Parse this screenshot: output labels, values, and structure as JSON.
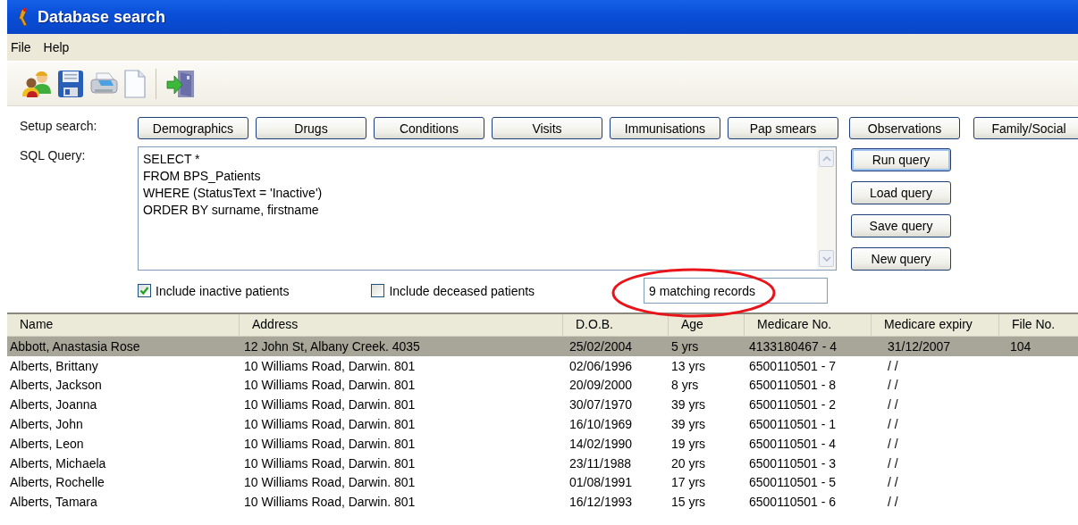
{
  "window": {
    "title": "Database search"
  },
  "menu": [
    "File",
    "Help"
  ],
  "toolbar": [
    {
      "kind": "people"
    },
    {
      "kind": "save"
    },
    {
      "kind": "print"
    },
    {
      "kind": "new"
    },
    {
      "kind": "separator"
    },
    {
      "kind": "exit"
    }
  ],
  "setup_search": {
    "label": "Setup search:",
    "buttons": [
      "Demographics",
      "Drugs",
      "Conditions",
      "Visits",
      "Immunisations",
      "Pap smears",
      "Observations",
      "Family/Social"
    ]
  },
  "sql_query": {
    "label": "SQL Query:",
    "lines": [
      "SELECT *",
      "FROM BPS_Patients",
      "WHERE (StatusText = 'Inactive')",
      "ORDER BY surname, firstname"
    ]
  },
  "query_buttons": [
    {
      "label": "Run query",
      "default": true
    },
    {
      "label": "Load query",
      "default": false
    },
    {
      "label": "Save query",
      "default": false
    },
    {
      "label": "New query",
      "default": false
    }
  ],
  "options": [
    {
      "label": "Include inactive patients",
      "checked": true
    },
    {
      "label": "Include deceased patients",
      "checked": false
    }
  ],
  "result_count": "9 matching records",
  "table": {
    "columns": [
      "Name",
      "Address",
      "D.O.B.",
      "Age",
      "Medicare No.",
      "Medicare expiry",
      "File No."
    ],
    "rows": [
      {
        "selected": true,
        "cells": [
          "Abbott, Anastasia Rose",
          "12 John St, Albany Creek. 4035",
          "25/02/2004",
          "5 yrs",
          "4133180467 - 4",
          "31/12/2007",
          "104"
        ]
      },
      {
        "selected": false,
        "cells": [
          "Alberts, Brittany",
          "10 Williams Road, Darwin. 801",
          "02/06/1996",
          "13 yrs",
          "6500110501 - 7",
          "/ /",
          ""
        ]
      },
      {
        "selected": false,
        "cells": [
          "Alberts, Jackson",
          "10 Williams Road, Darwin. 801",
          "20/09/2000",
          "8 yrs",
          "6500110501 - 8",
          "/ /",
          ""
        ]
      },
      {
        "selected": false,
        "cells": [
          "Alberts, Joanna",
          "10 Williams Road, Darwin. 801",
          "30/07/1970",
          "39 yrs",
          "6500110501 - 2",
          "/ /",
          ""
        ]
      },
      {
        "selected": false,
        "cells": [
          "Alberts, John",
          "10 Williams Road, Darwin. 801",
          "16/10/1969",
          "39 yrs",
          "6500110501 - 1",
          "/ /",
          ""
        ]
      },
      {
        "selected": false,
        "cells": [
          "Alberts, Leon",
          "10 Williams Road, Darwin. 801",
          "14/02/1990",
          "19 yrs",
          "6500110501 - 4",
          "/ /",
          ""
        ]
      },
      {
        "selected": false,
        "cells": [
          "Alberts, Michaela",
          "10 Williams Road, Darwin. 801",
          "23/11/1988",
          "20 yrs",
          "6500110501 - 3",
          "/ /",
          ""
        ]
      },
      {
        "selected": false,
        "cells": [
          "Alberts, Rochelle",
          "10 Williams Road, Darwin. 801",
          "01/08/1991",
          "17 yrs",
          "6500110501 - 5",
          "/ /",
          ""
        ]
      },
      {
        "selected": false,
        "cells": [
          "Alberts, Tamara",
          "10 Williams Road, Darwin. 801",
          "16/12/1993",
          "15 yrs",
          "6500110501 - 6",
          "/ /",
          ""
        ]
      }
    ]
  }
}
